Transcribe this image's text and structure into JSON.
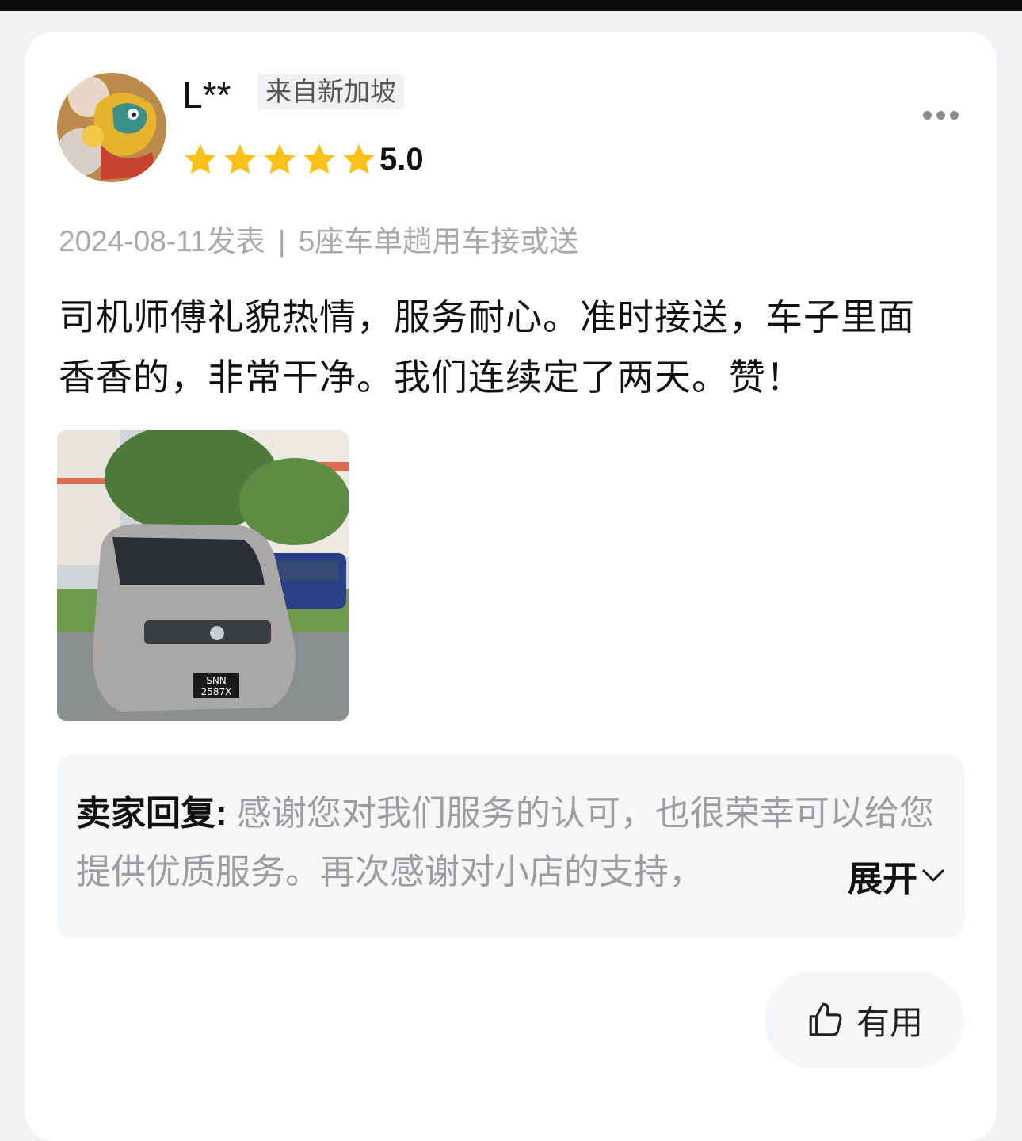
{
  "review": {
    "user": {
      "name": "L**",
      "location": "来自新加坡",
      "rating": 5,
      "score": "5.0"
    },
    "meta": {
      "date": "2024-08-11发表",
      "separator": "|",
      "product": "5座车单趟用车接或送"
    },
    "content": "司机师傅礼貌热情，服务耐心。准时接送，车子里面香香的，非常干净。我们连续定了两天。赞！",
    "photo": {
      "plate_line1": "SNN",
      "plate_line2": "2587X"
    },
    "seller_reply": {
      "label": "卖家回复:",
      "text": " 感谢您对我们服务的认可，也很荣幸可以给您提供优质服务。再次感谢对小店的支持，",
      "expand_label": "展开"
    },
    "useful_label": "有用"
  },
  "colors": {
    "star": "#f9c21a",
    "muted_text": "#a9a9ad",
    "card_bg": "#ffffff",
    "page_bg": "#f2f2f4"
  },
  "icons": [
    "more-icon",
    "star-icon",
    "chevron-down-icon",
    "thumbs-up-icon"
  ]
}
